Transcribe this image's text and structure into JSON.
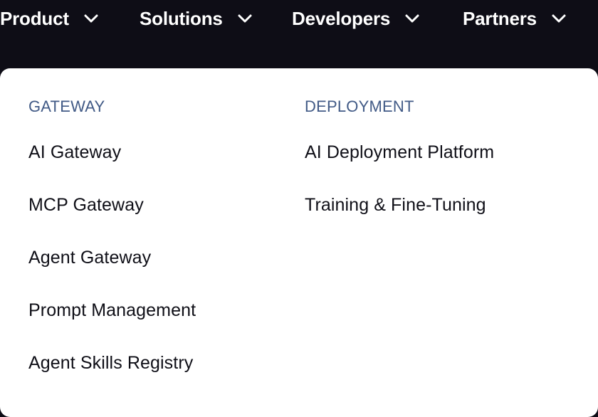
{
  "nav": {
    "items": [
      {
        "label": "Product"
      },
      {
        "label": "Solutions"
      },
      {
        "label": "Developers"
      },
      {
        "label": "Partners"
      }
    ]
  },
  "dropdown": {
    "columns": [
      {
        "heading": "GATEWAY",
        "links": [
          "AI Gateway",
          "MCP Gateway",
          "Agent Gateway",
          "Prompt Management",
          "Agent Skills Registry"
        ]
      },
      {
        "heading": "DEPLOYMENT",
        "links": [
          "AI Deployment Platform",
          "Training & Fine-Tuning"
        ]
      }
    ]
  },
  "colors": {
    "background": "#0e0d16",
    "panel": "#ffffff",
    "heading": "#415a86",
    "link": "#0f0f17"
  }
}
